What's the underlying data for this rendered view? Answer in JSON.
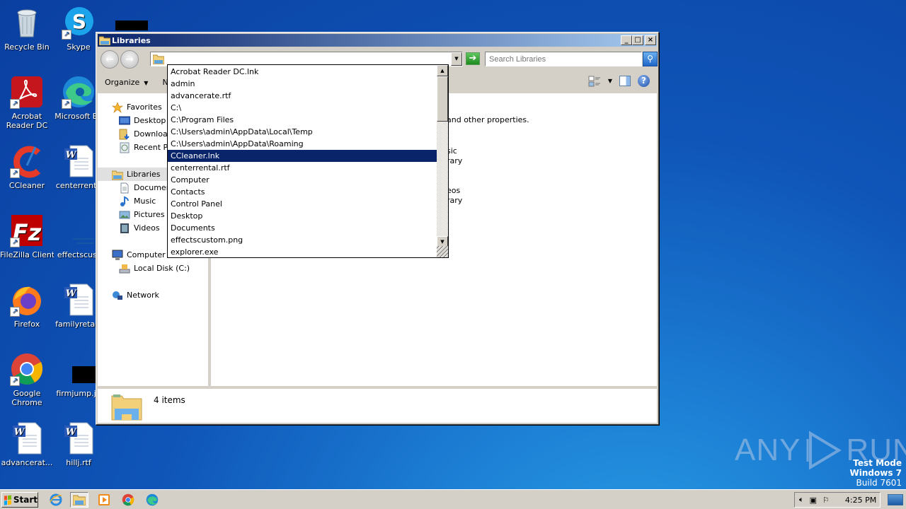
{
  "desktop": {
    "icons": [
      {
        "label": "Recycle Bin",
        "icon": "recycle-bin-icon"
      },
      {
        "label": "Skype",
        "icon": "skype-icon"
      },
      {
        "label": "Acrobat Reader DC",
        "label_line1": "Acrobat",
        "label_line2": "Reader DC",
        "icon": "acrobat-icon"
      },
      {
        "label": "Microsoft Edge",
        "display": "Microsoft Ed",
        "icon": "edge-icon"
      },
      {
        "label": "CCleaner",
        "icon": "ccleaner-icon"
      },
      {
        "label": "centerrental",
        "display": "centerrenta",
        "icon": "word-doc-icon"
      },
      {
        "label": "FileZilla Client",
        "icon": "filezilla-icon"
      },
      {
        "label": "effectscustom",
        "display": "effectscust",
        "icon": "image-file-icon"
      },
      {
        "label": "Firefox",
        "icon": "firefox-icon"
      },
      {
        "label": "familyretail",
        "display": "familyretail.",
        "icon": "word-doc-icon"
      },
      {
        "label": "Google Chrome",
        "label_line1": "Google",
        "label_line2": "Chrome",
        "icon": "chrome-icon"
      },
      {
        "label": "firmjump.jpg",
        "display": "firmjump.jp",
        "icon": "image-file-icon"
      },
      {
        "label": "advancerate.rtf",
        "display": "advancerat...",
        "icon": "word-doc-icon"
      },
      {
        "label": "hillj.rtf",
        "icon": "word-doc-icon"
      }
    ]
  },
  "window": {
    "title": "Libraries",
    "address_value": "",
    "search_placeholder": "Search Libraries",
    "toolbar": {
      "organize": "Organize",
      "new_partial": "N"
    },
    "nav": {
      "favorites": "Favorites",
      "favorites_items": [
        "Desktop",
        "Downloads",
        "Recent Places"
      ],
      "favorites_display": [
        "Desktop",
        "Downloads",
        "Recent Pla"
      ],
      "libraries": "Libraries",
      "libraries_items": [
        "Documents",
        "Music",
        "Pictures",
        "Videos"
      ],
      "libraries_display": [
        "Document",
        "Music",
        "Pictures",
        "Videos"
      ],
      "computer": "Computer",
      "computer_items": [
        "Local Disk (C:)"
      ],
      "network": "Network"
    },
    "content": {
      "description_partial": "and other properties.",
      "music_partial": "sic",
      "music_sub_partial": "rary",
      "videos_partial": "eos",
      "videos_sub_partial": "rary"
    },
    "status": {
      "item_count": "4 items"
    }
  },
  "autocomplete": {
    "selected_index": 7,
    "items": [
      "Acrobat Reader DC.lnk",
      "admin",
      "advancerate.rtf",
      "C:\\",
      "C:\\Program Files",
      "C:\\Users\\admin\\AppData\\Local\\Temp",
      "C:\\Users\\admin\\AppData\\Roaming",
      "CCleaner.lnk",
      "centerrental.rtf",
      "Computer",
      "Contacts",
      "Control Panel",
      "Desktop",
      "Documents",
      "effectscustom.png",
      "explorer.exe"
    ]
  },
  "taskbar": {
    "start_label": "Start",
    "apps": [
      "Internet Explorer",
      "Windows Explorer",
      "Windows Media Player",
      "Google Chrome",
      "Microsoft Edge"
    ],
    "clock": "4:25 PM"
  },
  "watermark": {
    "brand_left": "ANY",
    "brand_right": "RUN",
    "test_mode": "Test Mode",
    "os": "Windows 7",
    "build": "Build 7601"
  },
  "colors": {
    "selection": "#0a246a",
    "title_start": "#0a246a",
    "title_end": "#a6caf0",
    "chrome": "#d4d0c8"
  }
}
